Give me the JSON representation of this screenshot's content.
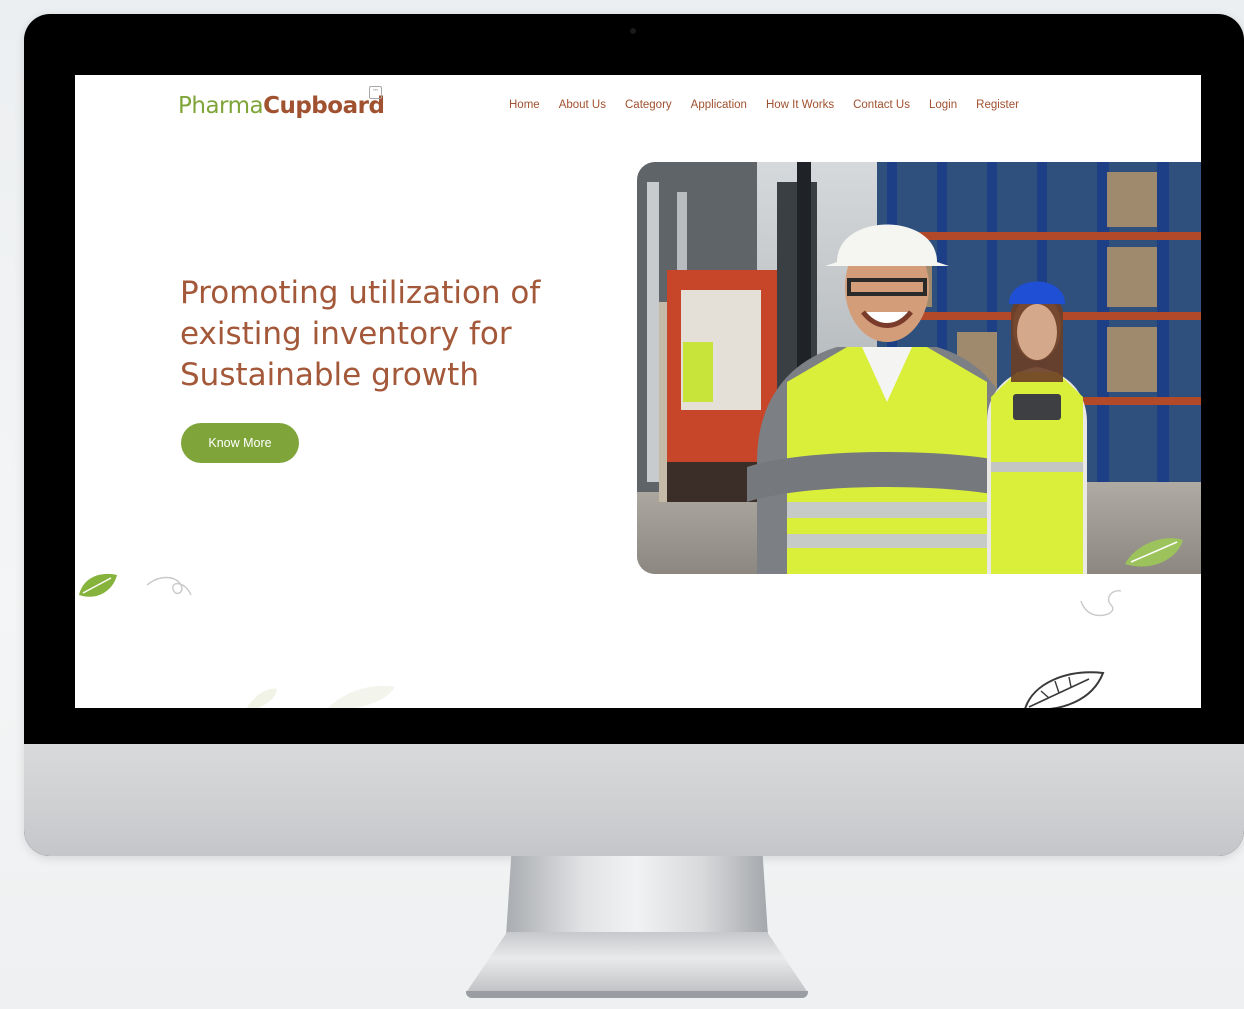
{
  "brand": {
    "part1": "Pharma",
    "part2": "Cupboard",
    "mark": "™"
  },
  "nav": {
    "items": [
      {
        "label": "Home"
      },
      {
        "label": "About Us"
      },
      {
        "label": "Category"
      },
      {
        "label": "Application"
      },
      {
        "label": "How It Works"
      },
      {
        "label": "Contact Us"
      },
      {
        "label": "Login"
      },
      {
        "label": "Register"
      }
    ]
  },
  "hero": {
    "title_lines": [
      "Promoting utilization of",
      "existing inventory for",
      "Sustainable growth"
    ],
    "cta_label": "Know More"
  },
  "colors": {
    "brand_green": "#7fa53a",
    "brand_brown": "#a0512f",
    "vest_yellow": "#d9ef3a"
  },
  "icons": [
    "leaf-icon",
    "camera-icon"
  ]
}
